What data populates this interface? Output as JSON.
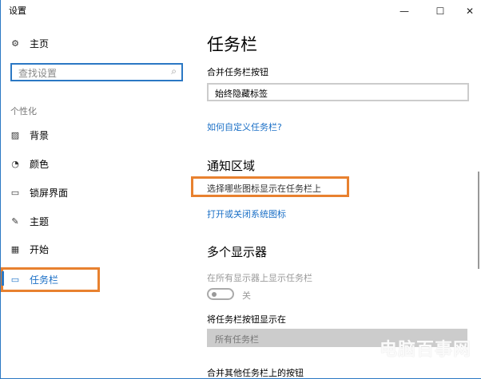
{
  "window": {
    "title": "设置",
    "minimize": "—",
    "maximize": "☐",
    "close": "✕"
  },
  "sidebar": {
    "home": "主页",
    "search_placeholder": "查找设置",
    "section": "个性化",
    "items": [
      {
        "label": "背景",
        "icon": "picture-icon",
        "glyph": "▨"
      },
      {
        "label": "颜色",
        "icon": "palette-icon",
        "glyph": "◔"
      },
      {
        "label": "锁屏界面",
        "icon": "lock-screen-icon",
        "glyph": "▭"
      },
      {
        "label": "主题",
        "icon": "theme-icon",
        "glyph": "✎"
      },
      {
        "label": "开始",
        "icon": "start-icon",
        "glyph": "▦"
      },
      {
        "label": "任务栏",
        "icon": "taskbar-icon",
        "glyph": "▭"
      }
    ]
  },
  "main": {
    "title": "任务栏",
    "combine_label": "合并任务栏按钮",
    "combine_value": "始终隐藏标签",
    "customize_link": "如何自定义任务栏?",
    "notify_title": "通知区域",
    "notify_link1": "选择哪些图标显示在任务栏上",
    "notify_link2": "打开或关闭系统图标",
    "multi_title": "多个显示器",
    "show_all_label": "在所有显示器上显示任务栏",
    "toggle_state": "关",
    "buttons_on_label": "将任务栏按钮显示在",
    "buttons_on_value": "所有任务栏",
    "combine_other_label": "合并其他任务栏上的按钮"
  },
  "watermark": "电脑百事网",
  "colors": {
    "accent": "#2b78c4",
    "highlight": "#e8812f"
  }
}
